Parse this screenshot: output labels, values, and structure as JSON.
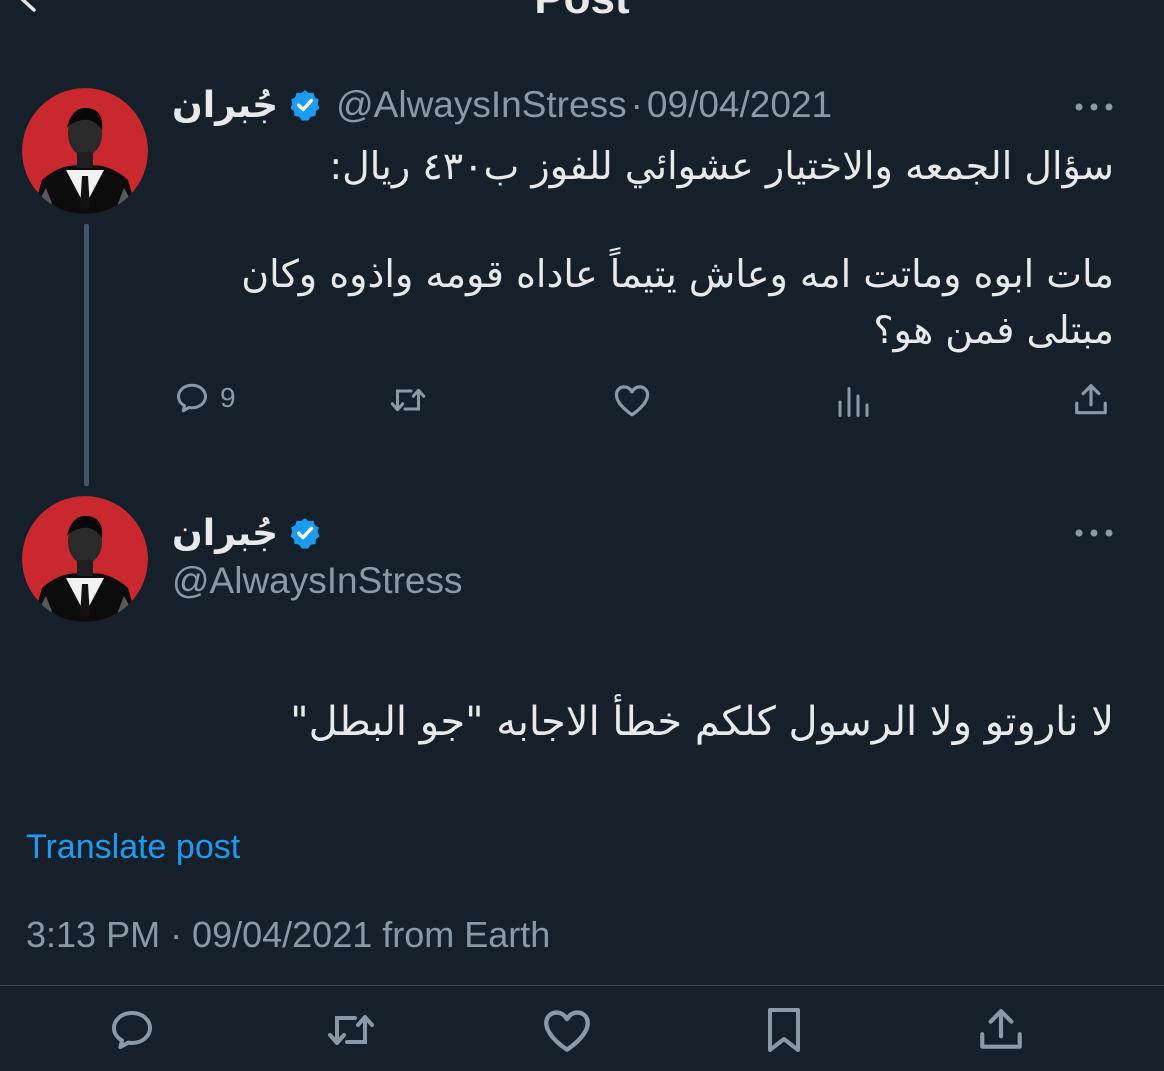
{
  "header": {
    "title": "Post"
  },
  "tweet_parent": {
    "display_name": "جُبران",
    "handle": "@AlwaysInStress",
    "separator": "·",
    "date": "09/04/2021",
    "text_line1": "سؤال الجمعه والاختيار عشوائي للفوز ب٤٣٠ ريال:",
    "text_line2": "مات ابوه وماتت امه وعاش يتيماً عاداه قومه واذوه وكان",
    "text_line3": "مبتلى فمن هو؟",
    "reply_count": "9"
  },
  "tweet_main": {
    "display_name": "جُبران",
    "handle": "@AlwaysInStress",
    "text": "لا ناروتو ولا الرسول كلكم خطأ الاجابه \"جو البطل\"",
    "translate_label": "Translate post",
    "timestamp": "3:13 PM · 09/04/2021 from Earth"
  },
  "colors": {
    "background": "#15202b",
    "text": "#e7e9ea",
    "muted": "#8b98a5",
    "accent": "#1d9bf0",
    "avatar_bg": "#c8282e"
  },
  "icons": {
    "back": "back-arrow-icon",
    "verified": "verified-badge-icon",
    "more": "more-options-icon",
    "reply": "reply-icon",
    "retweet": "retweet-icon",
    "like": "like-icon",
    "views": "views-icon",
    "share": "share-icon",
    "bookmark": "bookmark-icon"
  }
}
